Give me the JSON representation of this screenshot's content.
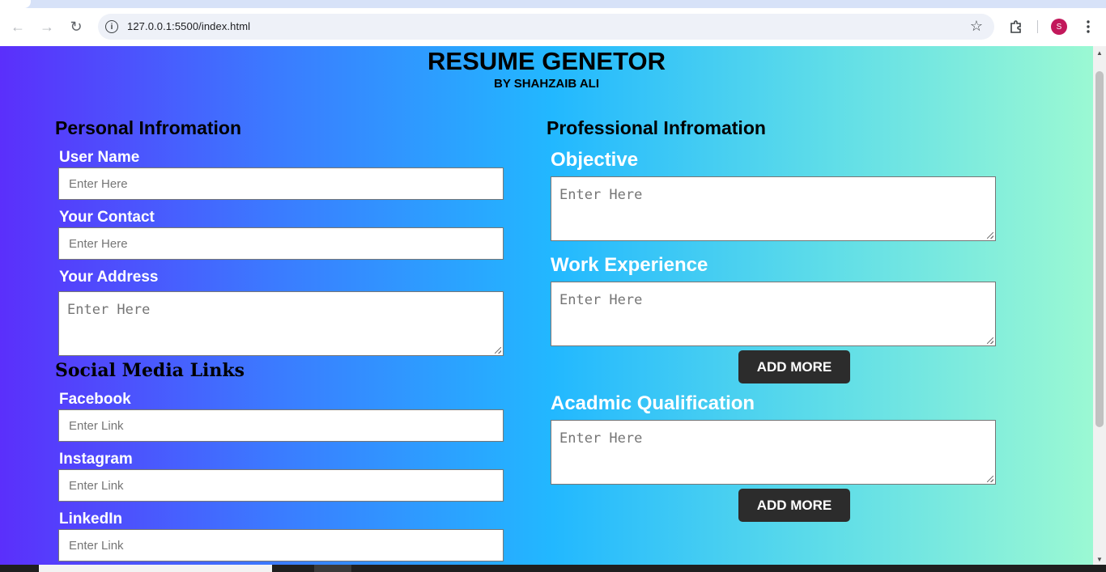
{
  "browser": {
    "url": "127.0.0.1:5500/index.html",
    "avatar_letter": "S",
    "avatar_color": "#c2185b"
  },
  "header": {
    "title": "RESUME GENETOR",
    "subtitle": "BY SHAHZAIB ALI"
  },
  "personal": {
    "heading": "Personal Infromation",
    "user_name_label": "User Name",
    "user_name_placeholder": "Enter Here",
    "contact_label": "Your Contact",
    "contact_placeholder": "Enter Here",
    "address_label": "Your Address",
    "address_placeholder": "Enter Here"
  },
  "social": {
    "heading": "Social Media Links",
    "facebook_label": "Facebook",
    "facebook_placeholder": "Enter Link",
    "instagram_label": "Instagram",
    "instagram_placeholder": "Enter Link",
    "linkedin_label": "LinkedIn",
    "linkedin_placeholder": "Enter Link"
  },
  "professional": {
    "heading": "Professional Infromation",
    "objective_label": "Objective",
    "objective_placeholder": "Enter Here",
    "experience_label": "Work Experience",
    "experience_placeholder": "Enter Here",
    "experience_add": "ADD MORE",
    "qualification_label": "Acadmic Qualification",
    "qualification_placeholder": "Enter Here",
    "qualification_add": "ADD MORE"
  },
  "colors": {
    "gradient_start": "#5b2ffb",
    "gradient_mid": "#22b8ff",
    "gradient_end": "#9efad2",
    "button_bg": "#2c2c2c"
  }
}
